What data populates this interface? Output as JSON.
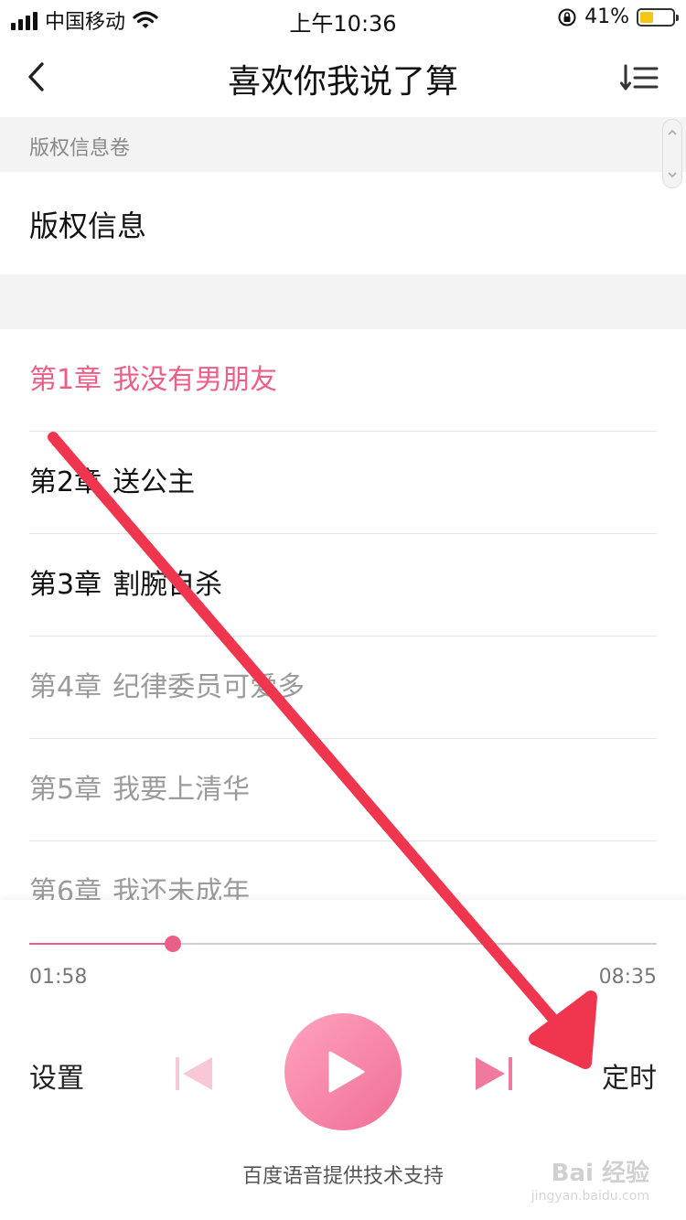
{
  "status_bar": {
    "carrier": "中国移动",
    "time": "上午10:36",
    "battery_percent": "41%",
    "battery_level": 0.41,
    "icons": [
      "signal-icon",
      "wifi-icon",
      "rotation-lock-icon",
      "battery-icon"
    ]
  },
  "nav": {
    "title": "喜欢你我说了算",
    "back_icon": "chevron-left-icon",
    "sort_icon": "sort-list-icon"
  },
  "volume_section": {
    "header": "版权信息卷",
    "item": "版权信息"
  },
  "chapters": [
    {
      "num": "第1章",
      "title": "我没有男朋友",
      "state": "active"
    },
    {
      "num": "第2章",
      "title": "送公主",
      "state": "normal"
    },
    {
      "num": "第3章",
      "title": "割腕自杀",
      "state": "normal"
    },
    {
      "num": "第4章",
      "title": "纪律委员可爱多",
      "state": "muted"
    },
    {
      "num": "第5章",
      "title": "我要上清华",
      "state": "muted"
    },
    {
      "num": "第6章",
      "title": "我还未成年",
      "state": "muted"
    }
  ],
  "player": {
    "elapsed": "01:58",
    "total": "08:35",
    "progress": 0.229,
    "settings_label": "设置",
    "timer_label": "定时",
    "credit": "百度语音提供技术支持",
    "icons": [
      "previous-icon",
      "play-icon",
      "next-icon"
    ],
    "accent_color": "#ec5f86"
  },
  "watermark": {
    "brand": "Bai 经验",
    "url": "jingyan.baidu.com"
  }
}
